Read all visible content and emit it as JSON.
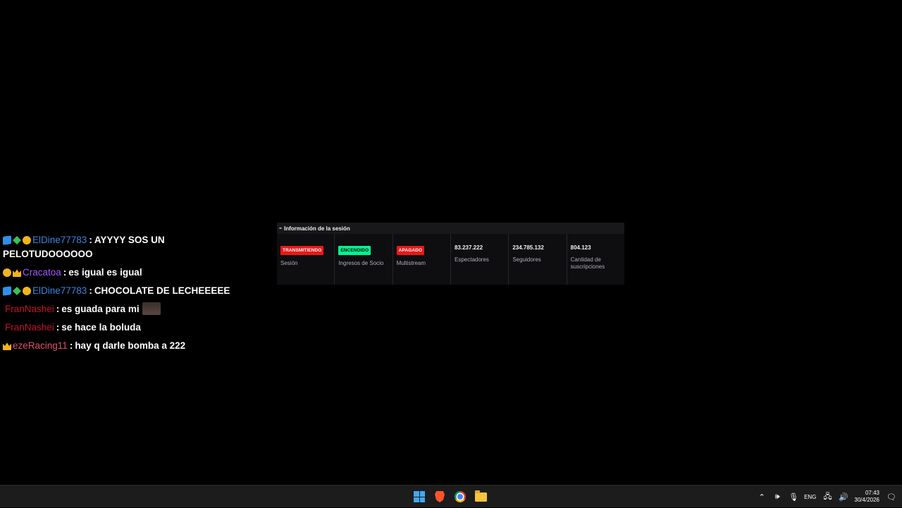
{
  "chat": {
    "messages": [
      {
        "user": "ElDine77783",
        "user_color": "#3d84e0",
        "badges": [
          "cube-badge",
          "gem-badge",
          "one-badge"
        ],
        "text": "AYYYY SOS UN PELOTUDOOOOOO"
      },
      {
        "user": "Cracatoa",
        "user_color": "#a45bff",
        "badges": [
          "one-badge",
          "crown-badge"
        ],
        "text": "es igual es igual"
      },
      {
        "user": "ElDine77783",
        "user_color": "#3d84e0",
        "badges": [
          "cube-badge",
          "gem-badge",
          "one-badge"
        ],
        "text": "CHOCOLATE DE LECHEEEEE"
      },
      {
        "user": "FranNashei",
        "user_color": "#c8102e",
        "badges": [],
        "text": "es guada para mi",
        "emote": "face-emote"
      },
      {
        "user": "FranNashei",
        "user_color": "#c8102e",
        "badges": [],
        "text": "se hace la boluda"
      },
      {
        "user": "ezeRacing11",
        "user_color": "#e0506a",
        "badges": [
          "crown-badge"
        ],
        "text": "hay q darle bomba a 222"
      }
    ],
    "separator": ":"
  },
  "session_panel": {
    "title": "Información de la sesión",
    "cells": [
      {
        "pill": "TRANSMITIENDO",
        "pill_color": "#e91916",
        "label": "Sesión"
      },
      {
        "pill": "ENCENDIDO",
        "pill_color": "#00f593",
        "label": "Ingresos de Socio"
      },
      {
        "pill": "APAGADO",
        "pill_color": "#e91916",
        "label": "Multistream"
      },
      {
        "value": "83.237.222",
        "label": "Espectadores"
      },
      {
        "value": "234.785.132",
        "label": "Seguidores"
      },
      {
        "value": "804.123",
        "label": "Cantidad de suscripciones"
      }
    ]
  },
  "taskbar": {
    "language": "ENG",
    "time": "07:43",
    "date": "30/4/2026",
    "icons": [
      "windows-start-icon",
      "brave-browser-icon",
      "chrome-icon",
      "file-explorer-icon"
    ]
  }
}
